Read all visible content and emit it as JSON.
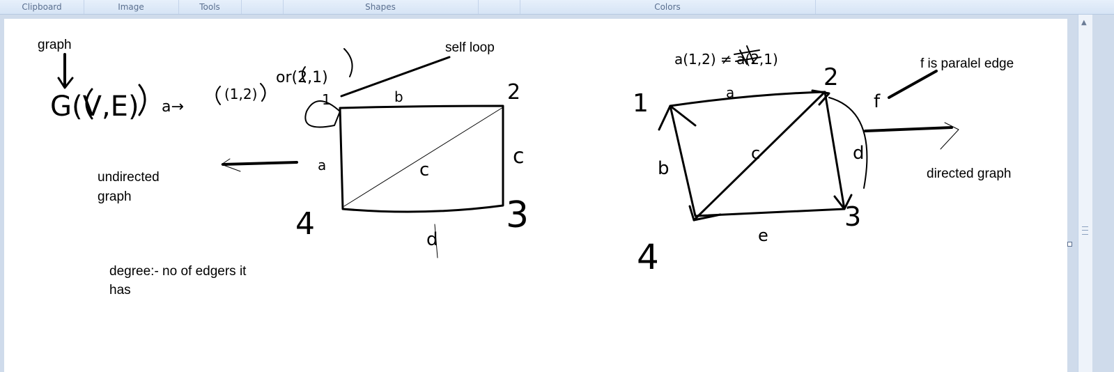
{
  "ribbon": {
    "groups": [
      "Clipboard",
      "Image",
      "Tools",
      "Shapes",
      "Colors"
    ]
  },
  "typed_text": {
    "graph": "graph",
    "self_loop": "self loop",
    "undirected_1": "undirected",
    "undirected_2": "graph",
    "degree_1": "degree:- no of edgers it",
    "degree_2": "has",
    "parallel_edge": "f is paralel edge",
    "directed_graph": "directed graph"
  },
  "handwriting": {
    "g_of_v_e": "G(V,E)",
    "a_to": "a→",
    "pair_12": "(1,2)",
    "or_21": "or(2,1)",
    "pair_note": "a(1,2) ≠ a(2,1)",
    "undirected": {
      "node1": "1",
      "node2": "2",
      "node3": "3",
      "node4": "4",
      "edge_a": "a",
      "edge_b": "b",
      "edge_c_right": "c",
      "edge_c_diag": "c",
      "edge_d": "d"
    },
    "directed": {
      "node1": "1",
      "node2": "2",
      "node3": "3",
      "node4": "4",
      "edge_a": "a",
      "edge_b": "b",
      "edge_c": "c",
      "edge_d": "d",
      "edge_e": "e",
      "edge_f": "f"
    }
  },
  "colors": {
    "ribbon_text": "#5a6f8f",
    "workspace": "#cfdbeb",
    "canvas": "#ffffff",
    "ink": "#000000"
  }
}
